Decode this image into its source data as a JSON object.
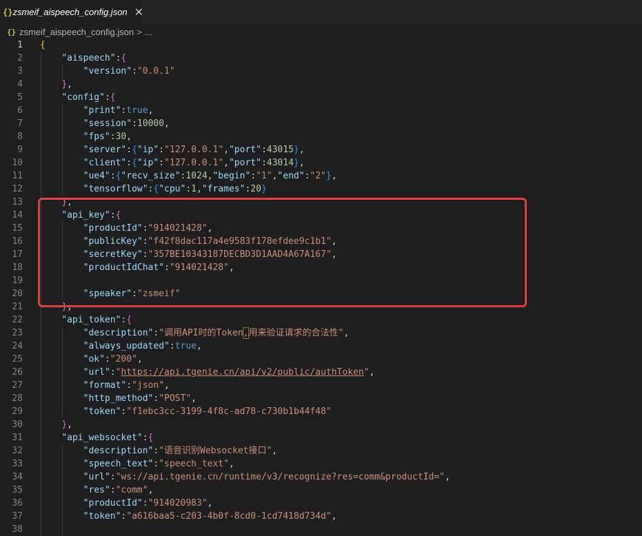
{
  "tab": {
    "icon_text": "{}",
    "title": "zsmeif_aispeech_config.json",
    "close_symbol": "✕"
  },
  "breadcrumb": {
    "icon_text": "{}",
    "file": "zsmeif_aispeech_config.json",
    "separator": ">",
    "more": "..."
  },
  "code_lines": [
    {
      "n": "1",
      "tokens": [
        {
          "t": "{",
          "c": "br1"
        }
      ]
    },
    {
      "n": "2",
      "tokens": [
        {
          "t": "    "
        },
        {
          "t": "\"aispeech\"",
          "c": "k"
        },
        {
          "t": ":"
        },
        {
          "t": "{",
          "c": "br2"
        }
      ]
    },
    {
      "n": "3",
      "tokens": [
        {
          "t": "        "
        },
        {
          "t": "\"version\"",
          "c": "k"
        },
        {
          "t": ":"
        },
        {
          "t": "\"0.0.1\"",
          "c": "s"
        }
      ]
    },
    {
      "n": "4",
      "tokens": [
        {
          "t": "    "
        },
        {
          "t": "}",
          "c": "br2"
        },
        {
          "t": ","
        }
      ]
    },
    {
      "n": "5",
      "tokens": [
        {
          "t": "    "
        },
        {
          "t": "\"config\"",
          "c": "k"
        },
        {
          "t": ":"
        },
        {
          "t": "{",
          "c": "br2"
        }
      ]
    },
    {
      "n": "6",
      "tokens": [
        {
          "t": "        "
        },
        {
          "t": "\"print\"",
          "c": "k"
        },
        {
          "t": ":"
        },
        {
          "t": "true",
          "c": "b"
        },
        {
          "t": ","
        }
      ]
    },
    {
      "n": "7",
      "tokens": [
        {
          "t": "        "
        },
        {
          "t": "\"session\"",
          "c": "k"
        },
        {
          "t": ":"
        },
        {
          "t": "10000",
          "c": "n"
        },
        {
          "t": ","
        }
      ]
    },
    {
      "n": "8",
      "tokens": [
        {
          "t": "        "
        },
        {
          "t": "\"fps\"",
          "c": "k"
        },
        {
          "t": ":"
        },
        {
          "t": "30",
          "c": "n"
        },
        {
          "t": ","
        }
      ]
    },
    {
      "n": "9",
      "tokens": [
        {
          "t": "        "
        },
        {
          "t": "\"server\"",
          "c": "k"
        },
        {
          "t": ":"
        },
        {
          "t": "{",
          "c": "br3"
        },
        {
          "t": "\"ip\"",
          "c": "k"
        },
        {
          "t": ":"
        },
        {
          "t": "\"127.0.0.1\"",
          "c": "s"
        },
        {
          "t": ","
        },
        {
          "t": "\"port\"",
          "c": "k"
        },
        {
          "t": ":"
        },
        {
          "t": "43015",
          "c": "n"
        },
        {
          "t": "}",
          "c": "br3"
        },
        {
          "t": ","
        }
      ]
    },
    {
      "n": "10",
      "tokens": [
        {
          "t": "        "
        },
        {
          "t": "\"client\"",
          "c": "k"
        },
        {
          "t": ":"
        },
        {
          "t": "{",
          "c": "br3"
        },
        {
          "t": "\"ip\"",
          "c": "k"
        },
        {
          "t": ":"
        },
        {
          "t": "\"127.0.0.1\"",
          "c": "s"
        },
        {
          "t": ","
        },
        {
          "t": "\"port\"",
          "c": "k"
        },
        {
          "t": ":"
        },
        {
          "t": "43014",
          "c": "n"
        },
        {
          "t": "}",
          "c": "br3"
        },
        {
          "t": ","
        }
      ]
    },
    {
      "n": "11",
      "tokens": [
        {
          "t": "        "
        },
        {
          "t": "\"ue4\"",
          "c": "k"
        },
        {
          "t": ":"
        },
        {
          "t": "{",
          "c": "br3"
        },
        {
          "t": "\"recv_size\"",
          "c": "k"
        },
        {
          "t": ":"
        },
        {
          "t": "1024",
          "c": "n"
        },
        {
          "t": ","
        },
        {
          "t": "\"begin\"",
          "c": "k"
        },
        {
          "t": ":"
        },
        {
          "t": "\"1\"",
          "c": "s"
        },
        {
          "t": ","
        },
        {
          "t": "\"end\"",
          "c": "k"
        },
        {
          "t": ":"
        },
        {
          "t": "\"2\"",
          "c": "s"
        },
        {
          "t": "}",
          "c": "br3"
        },
        {
          "t": ","
        }
      ]
    },
    {
      "n": "12",
      "tokens": [
        {
          "t": "        "
        },
        {
          "t": "\"tensorflow\"",
          "c": "k"
        },
        {
          "t": ":"
        },
        {
          "t": "{",
          "c": "br3"
        },
        {
          "t": "\"cpu\"",
          "c": "k"
        },
        {
          "t": ":"
        },
        {
          "t": "1",
          "c": "n"
        },
        {
          "t": ","
        },
        {
          "t": "\"frames\"",
          "c": "k"
        },
        {
          "t": ":"
        },
        {
          "t": "20",
          "c": "n"
        },
        {
          "t": "}",
          "c": "br3"
        }
      ]
    },
    {
      "n": "13",
      "tokens": [
        {
          "t": "    "
        },
        {
          "t": "}",
          "c": "br2"
        },
        {
          "t": ","
        }
      ]
    },
    {
      "n": "14",
      "tokens": [
        {
          "t": "    "
        },
        {
          "t": "\"api_key\"",
          "c": "k"
        },
        {
          "t": ":"
        },
        {
          "t": "{",
          "c": "br2"
        }
      ]
    },
    {
      "n": "15",
      "tokens": [
        {
          "t": "        "
        },
        {
          "t": "\"productId\"",
          "c": "k"
        },
        {
          "t": ":"
        },
        {
          "t": "\"914021428\"",
          "c": "s"
        },
        {
          "t": ","
        }
      ]
    },
    {
      "n": "16",
      "tokens": [
        {
          "t": "        "
        },
        {
          "t": "\"publicKey\"",
          "c": "k"
        },
        {
          "t": ":"
        },
        {
          "t": "\"f42f8dac117a4e9583f178efdee9c1b1\"",
          "c": "s"
        },
        {
          "t": ","
        }
      ]
    },
    {
      "n": "17",
      "tokens": [
        {
          "t": "        "
        },
        {
          "t": "\"secretKey\"",
          "c": "k"
        },
        {
          "t": ":"
        },
        {
          "t": "\"357BE10343187DECBD3D1AAD4A67A167\"",
          "c": "s"
        },
        {
          "t": ","
        }
      ]
    },
    {
      "n": "18",
      "tokens": [
        {
          "t": "        "
        },
        {
          "t": "\"productIdChat\"",
          "c": "k"
        },
        {
          "t": ":"
        },
        {
          "t": "\"914021428\"",
          "c": "s"
        },
        {
          "t": ","
        }
      ]
    },
    {
      "n": "19",
      "tokens": []
    },
    {
      "n": "20",
      "tokens": [
        {
          "t": "        "
        },
        {
          "t": "\"speaker\"",
          "c": "k"
        },
        {
          "t": ":"
        },
        {
          "t": "\"zsmeif\"",
          "c": "s"
        }
      ]
    },
    {
      "n": "21",
      "tokens": [
        {
          "t": "    "
        },
        {
          "t": "}",
          "c": "br2"
        },
        {
          "t": ","
        }
      ]
    },
    {
      "n": "22",
      "tokens": [
        {
          "t": "    "
        },
        {
          "t": "\"api_token\"",
          "c": "k"
        },
        {
          "t": ":"
        },
        {
          "t": "{",
          "c": "br2"
        }
      ]
    },
    {
      "n": "23",
      "tokens": [
        {
          "t": "        "
        },
        {
          "t": "\"description\"",
          "c": "k"
        },
        {
          "t": ":"
        },
        {
          "t": "\"调用API时的Token",
          "c": "s"
        },
        {
          "t": ",",
          "c": "s hl"
        },
        {
          "t": "用来验证请求的合法性\"",
          "c": "s"
        },
        {
          "t": ","
        }
      ]
    },
    {
      "n": "24",
      "tokens": [
        {
          "t": "        "
        },
        {
          "t": "\"always_updated\"",
          "c": "k"
        },
        {
          "t": ":"
        },
        {
          "t": "true",
          "c": "b"
        },
        {
          "t": ","
        }
      ]
    },
    {
      "n": "25",
      "tokens": [
        {
          "t": "        "
        },
        {
          "t": "\"ok\"",
          "c": "k"
        },
        {
          "t": ":"
        },
        {
          "t": "\"200\"",
          "c": "s"
        },
        {
          "t": ","
        }
      ]
    },
    {
      "n": "26",
      "tokens": [
        {
          "t": "        "
        },
        {
          "t": "\"url\"",
          "c": "k"
        },
        {
          "t": ":"
        },
        {
          "t": "\"",
          "c": "s"
        },
        {
          "t": "https://api.tgenie.cn/api/v2/public/authToken",
          "c": "s u"
        },
        {
          "t": "\"",
          "c": "s"
        },
        {
          "t": ","
        }
      ]
    },
    {
      "n": "27",
      "tokens": [
        {
          "t": "        "
        },
        {
          "t": "\"format\"",
          "c": "k"
        },
        {
          "t": ":"
        },
        {
          "t": "\"json\"",
          "c": "s"
        },
        {
          "t": ","
        }
      ]
    },
    {
      "n": "28",
      "tokens": [
        {
          "t": "        "
        },
        {
          "t": "\"http_method\"",
          "c": "k"
        },
        {
          "t": ":"
        },
        {
          "t": "\"POST\"",
          "c": "s"
        },
        {
          "t": ","
        }
      ]
    },
    {
      "n": "29",
      "tokens": [
        {
          "t": "        "
        },
        {
          "t": "\"token\"",
          "c": "k"
        },
        {
          "t": ":"
        },
        {
          "t": "\"f1ebc3cc-3199-4f8c-ad78-c730b1b44f48\"",
          "c": "s"
        }
      ]
    },
    {
      "n": "30",
      "tokens": [
        {
          "t": "    "
        },
        {
          "t": "}",
          "c": "br2"
        },
        {
          "t": ","
        }
      ]
    },
    {
      "n": "31",
      "tokens": [
        {
          "t": "    "
        },
        {
          "t": "\"api_websocket\"",
          "c": "k"
        },
        {
          "t": ":"
        },
        {
          "t": "{",
          "c": "br2"
        }
      ]
    },
    {
      "n": "32",
      "tokens": [
        {
          "t": "        "
        },
        {
          "t": "\"description\"",
          "c": "k"
        },
        {
          "t": ":"
        },
        {
          "t": "\"语音识别Websocket接口\"",
          "c": "s"
        },
        {
          "t": ","
        }
      ]
    },
    {
      "n": "33",
      "tokens": [
        {
          "t": "        "
        },
        {
          "t": "\"speech_text\"",
          "c": "k"
        },
        {
          "t": ":"
        },
        {
          "t": "\"speech_text\"",
          "c": "s"
        },
        {
          "t": ","
        }
      ]
    },
    {
      "n": "34",
      "tokens": [
        {
          "t": "        "
        },
        {
          "t": "\"url\"",
          "c": "k"
        },
        {
          "t": ":"
        },
        {
          "t": "\"ws://api.tgenie.cn/runtime/v3/recognize?res=comm&productId=\"",
          "c": "s"
        },
        {
          "t": ","
        }
      ]
    },
    {
      "n": "35",
      "tokens": [
        {
          "t": "        "
        },
        {
          "t": "\"res\"",
          "c": "k"
        },
        {
          "t": ":"
        },
        {
          "t": "\"comm\"",
          "c": "s"
        },
        {
          "t": ","
        }
      ]
    },
    {
      "n": "36",
      "tokens": [
        {
          "t": "        "
        },
        {
          "t": "\"productId\"",
          "c": "k"
        },
        {
          "t": ":"
        },
        {
          "t": "\"914020983\"",
          "c": "s"
        },
        {
          "t": ","
        }
      ]
    },
    {
      "n": "37",
      "tokens": [
        {
          "t": "        "
        },
        {
          "t": "\"token\"",
          "c": "k"
        },
        {
          "t": ":"
        },
        {
          "t": "\"a616baa5-c203-4b0f-8cd0-1cd7418d734d\"",
          "c": "s"
        },
        {
          "t": ","
        }
      ]
    },
    {
      "n": "38",
      "tokens": []
    }
  ],
  "active_line": "1",
  "colors": {
    "highlight_box": "#e0413e",
    "editor_bg": "#1e1e1e",
    "key": "#9cdcfe",
    "string": "#ce9178",
    "number": "#b5cea8"
  }
}
